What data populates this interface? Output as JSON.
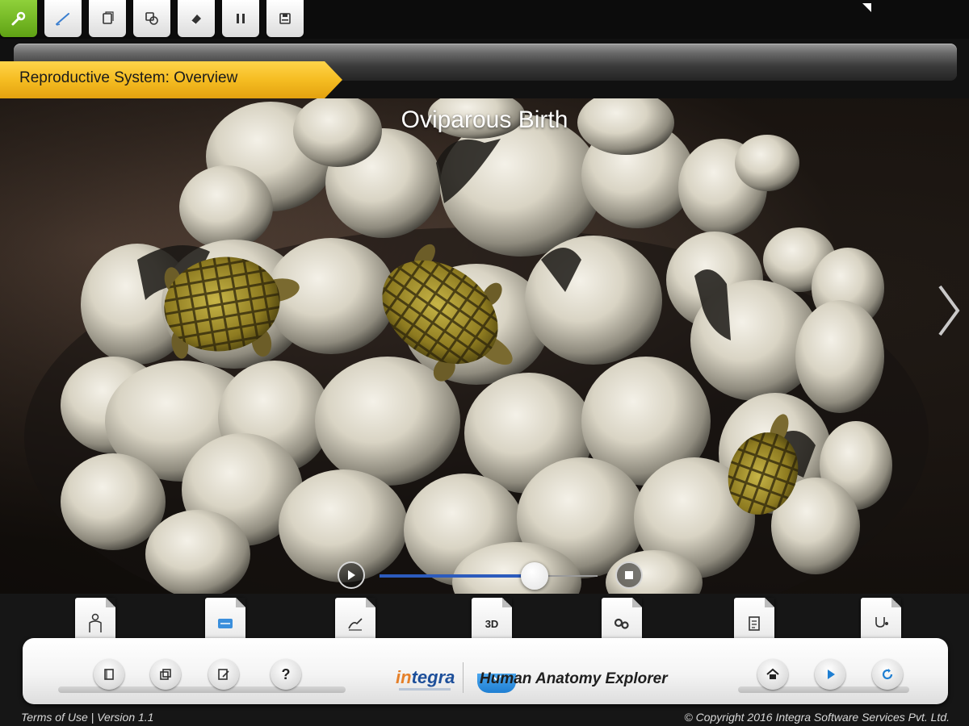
{
  "toolbar": {
    "tools": [
      {
        "name": "wrench-icon",
        "active": true
      },
      {
        "name": "pen-icon",
        "active": false
      },
      {
        "name": "copy-icon",
        "active": false
      },
      {
        "name": "duplicate-icon",
        "active": false
      },
      {
        "name": "eraser-icon",
        "active": false
      },
      {
        "name": "pause-icon",
        "active": false
      },
      {
        "name": "save-icon",
        "active": false
      }
    ],
    "active_color": "#76bd25"
  },
  "header": {
    "breadcrumb_title": "Reproductive System: Overview",
    "ribbon_color": "#f5bd22"
  },
  "stage": {
    "title": "Oviparous Birth",
    "player": {
      "progress": 0.71,
      "accent": "#2c5bbd"
    }
  },
  "tabs": [
    {
      "name": "tab-anatomy",
      "icon": "body-outline-icon",
      "label": ""
    },
    {
      "name": "tab-display",
      "icon": "display-icon",
      "label": ""
    },
    {
      "name": "tab-draw",
      "icon": "hand-draw-icon",
      "label": ""
    },
    {
      "name": "tab-3d",
      "icon": "",
      "label": "3D"
    },
    {
      "name": "tab-settings",
      "icon": "gears-icon",
      "label": ""
    },
    {
      "name": "tab-notes",
      "icon": "notes-icon",
      "label": ""
    },
    {
      "name": "tab-stethoscope",
      "icon": "stethoscope-icon",
      "label": ""
    }
  ],
  "panel": {
    "left_buttons": [
      "book-icon",
      "copy-icon",
      "edit-note-icon",
      "help-icon"
    ],
    "help_label": "?",
    "right_buttons": [
      "home-icon",
      "play-icon",
      "refresh-icon"
    ],
    "brand": {
      "prefix": "in",
      "suffix": "tegra"
    },
    "app_name": "Human Anatomy Explorer"
  },
  "footer": {
    "terms": "Terms of Use",
    "separator": "|",
    "version": "Version 1.1",
    "copyright": "© Copyright 2016 Integra Software Services Pvt. Ltd."
  }
}
